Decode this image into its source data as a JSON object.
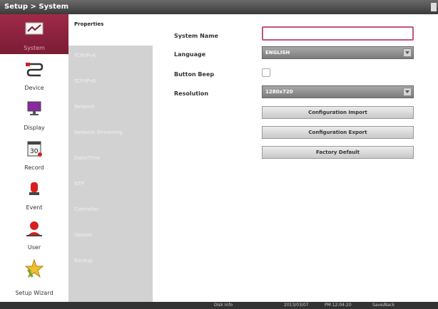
{
  "header": {
    "title": "Setup > System"
  },
  "sidebar": {
    "items": [
      {
        "label": "System",
        "icon": "system-settings-icon"
      },
      {
        "label": "Device",
        "icon": "device-cable-icon"
      },
      {
        "label": "Display",
        "icon": "display-monitor-icon"
      },
      {
        "label": "Record",
        "icon": "record-calendar-icon"
      },
      {
        "label": "Event",
        "icon": "event-siren-icon"
      },
      {
        "label": "User",
        "icon": "user-avatar-icon"
      },
      {
        "label": "Setup Wizard",
        "icon": "setup-wizard-star-icon"
      }
    ]
  },
  "submenu": {
    "items": [
      {
        "label": "Properties"
      },
      {
        "label": "TCP/IPv4"
      },
      {
        "label": "TCP/IPv6"
      },
      {
        "label": "Network"
      },
      {
        "label": "Network Streaming"
      },
      {
        "label": "Date/Time"
      },
      {
        "label": "NTP"
      },
      {
        "label": "Controller"
      },
      {
        "label": "Update"
      },
      {
        "label": "Backup"
      }
    ]
  },
  "form": {
    "system_name_label": "System Name",
    "system_name_value": "",
    "language_label": "Language",
    "language_value": "ENGLISH",
    "button_beep_label": "Button Beep",
    "button_beep_checked": false,
    "resolution_label": "Resolution",
    "resolution_value": "1280x720",
    "config_import_label": "Configuration Import",
    "config_export_label": "Configuration Export",
    "factory_default_label": "Factory Default"
  },
  "status": {
    "text1": "Disk Info",
    "date": "2013/03/07",
    "time": "PM 12:04:20",
    "back_label": "Save/Back"
  },
  "colors": {
    "accent": "#9a2742",
    "menu_bg": "#d2d2d2"
  }
}
